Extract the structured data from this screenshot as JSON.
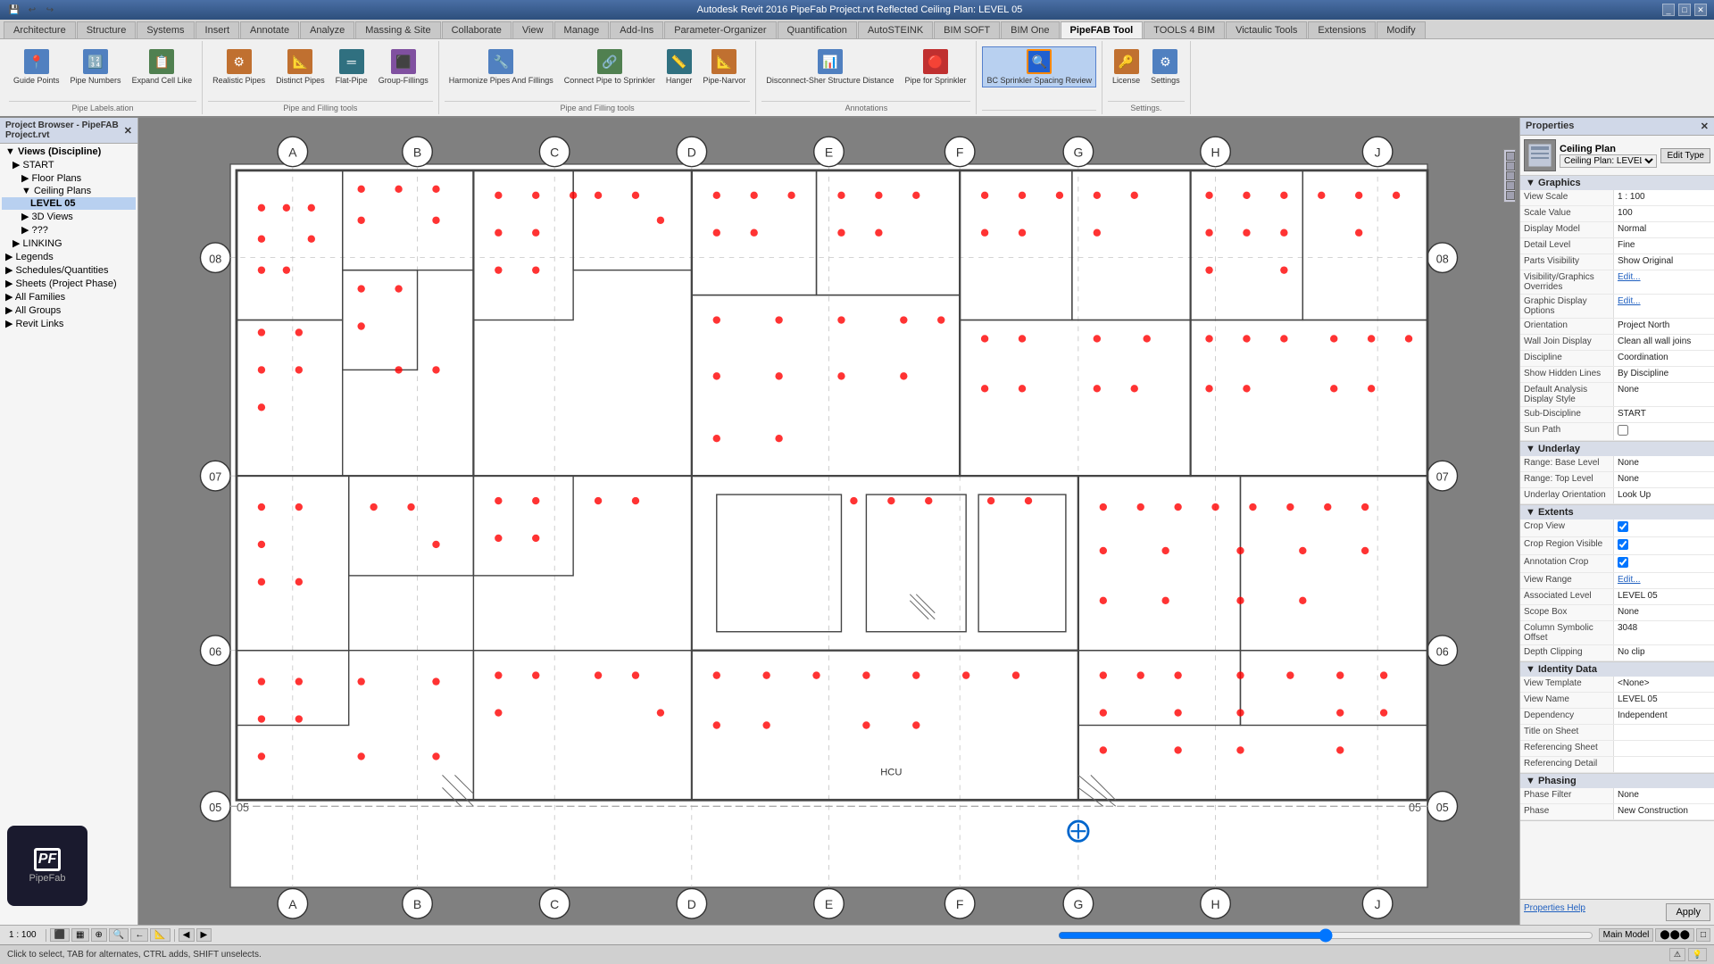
{
  "titleBar": {
    "text": "Autodesk Revit 2016    PipeFab Project.rvt    Reflected Ceiling Plan: LEVEL 05",
    "controls": [
      "minimize",
      "restore",
      "close"
    ]
  },
  "ribbonTabs": {
    "tabs": [
      {
        "label": "Architecture",
        "active": false
      },
      {
        "label": "Structure",
        "active": false
      },
      {
        "label": "Systems",
        "active": false
      },
      {
        "label": "Insert",
        "active": false
      },
      {
        "label": "Annotate",
        "active": false
      },
      {
        "label": "Analyze",
        "active": false
      },
      {
        "label": "Massing & Site",
        "active": false
      },
      {
        "label": "Collaborate",
        "active": false
      },
      {
        "label": "View",
        "active": false
      },
      {
        "label": "Manage",
        "active": false
      },
      {
        "label": "Add-Ins",
        "active": false
      },
      {
        "label": "Parameter-Organizer",
        "active": false
      },
      {
        "label": "Quantification",
        "active": false
      },
      {
        "label": "AutoSTEINK",
        "active": false
      },
      {
        "label": "BIM SOFT",
        "active": false
      },
      {
        "label": "BIM One",
        "active": false
      },
      {
        "label": "PipeFAB Tool",
        "active": false
      },
      {
        "label": "TOOLS 4 BIM",
        "active": false
      },
      {
        "label": "Victaulic Tools",
        "active": false
      },
      {
        "label": "Extensions",
        "active": false
      },
      {
        "label": "Modify",
        "active": false
      }
    ]
  },
  "ribbon": {
    "groups": [
      {
        "label": "Pipe Labels.ation",
        "tools": [
          {
            "icon": "📍",
            "label": "Guide Points",
            "color": "blue"
          },
          {
            "icon": "🔢",
            "label": "Pipe Numbers",
            "color": "blue"
          },
          {
            "icon": "📋",
            "label": "Expand Cell Like",
            "color": "green"
          }
        ]
      },
      {
        "label": "",
        "tools": [
          {
            "icon": "⚙",
            "label": "Realistic Pipes",
            "color": "orange"
          },
          {
            "icon": "📐",
            "label": "Distinct Pipes",
            "color": "orange"
          },
          {
            "icon": "═",
            "label": "Flat-Pipe",
            "color": "teal"
          },
          {
            "icon": "⬛",
            "label": "Group-Fillings",
            "color": "purple"
          }
        ]
      },
      {
        "label": "Pipe and Filling tools",
        "tools": [
          {
            "icon": "🔧",
            "label": "Harmonize Pipes And Fillings",
            "color": "blue"
          },
          {
            "icon": "🔗",
            "label": "Connect Pipe to Sprinkler",
            "color": "green"
          },
          {
            "icon": "📏",
            "label": "Hanger",
            "color": "teal"
          },
          {
            "icon": "📐",
            "label": "Pipe-Narvor",
            "color": "orange"
          }
        ]
      },
      {
        "label": "Annotations",
        "tools": [
          {
            "icon": "📊",
            "label": "Disconnect-Sher Structure Distance",
            "color": "blue"
          },
          {
            "icon": "🔴",
            "label": "Pipe for Sprinkler",
            "color": "red"
          }
        ]
      },
      {
        "label": "",
        "tools": [
          {
            "icon": "🔍",
            "label": "BC Sprinkler Spacing Review",
            "color": "active-blue",
            "active": true
          }
        ]
      },
      {
        "label": "Settings.",
        "tools": [
          {
            "icon": "⚙",
            "label": "License",
            "color": "orange"
          },
          {
            "icon": "🔧",
            "label": "Settings",
            "color": "blue"
          }
        ]
      }
    ]
  },
  "projectBrowser": {
    "title": "Project Browser - PipeFAB Project.rvt",
    "items": [
      {
        "label": "Views (Discipline)",
        "indent": 0,
        "arrow": "▼",
        "bold": true
      },
      {
        "label": "START",
        "indent": 1,
        "arrow": "▶",
        "bold": false
      },
      {
        "label": "Floor Plans",
        "indent": 2,
        "arrow": "▶",
        "bold": false
      },
      {
        "label": "Ceiling Plans",
        "indent": 2,
        "arrow": "▼",
        "bold": false
      },
      {
        "label": "LEVEL 05",
        "indent": 3,
        "arrow": "",
        "bold": true,
        "selected": true
      },
      {
        "label": "3D Views",
        "indent": 2,
        "arrow": "▶",
        "bold": false
      },
      {
        "label": "???",
        "indent": 2,
        "arrow": "▶",
        "bold": false
      },
      {
        "label": "LINKING",
        "indent": 1,
        "arrow": "▶",
        "bold": false
      },
      {
        "label": "Legends",
        "indent": 0,
        "arrow": "▶",
        "bold": false
      },
      {
        "label": "Schedules/Quantities",
        "indent": 0,
        "arrow": "▶",
        "bold": false
      },
      {
        "label": "Sheets (Project Phase)",
        "indent": 0,
        "arrow": "▶",
        "bold": false
      },
      {
        "label": "All Families",
        "indent": 0,
        "arrow": "▶",
        "bold": false
      },
      {
        "label": "All Groups",
        "indent": 0,
        "arrow": "▶",
        "bold": false
      },
      {
        "label": "Revit Links",
        "indent": 0,
        "arrow": "▶",
        "bold": false
      }
    ]
  },
  "properties": {
    "title": "Properties",
    "typeIcon": "🏗",
    "typeName": "Ceiling Plan",
    "typeSelector": "Ceiling Plan: LEVEL 05",
    "editTypeBtn": "Edit Type",
    "sections": [
      {
        "name": "Graphics",
        "rows": [
          {
            "label": "View Scale",
            "value": "1 : 100"
          },
          {
            "label": "Scale Value",
            "value": "100"
          },
          {
            "label": "Display Model",
            "value": "Normal"
          },
          {
            "label": "Detail Level",
            "value": "Fine"
          },
          {
            "label": "Parts Visibility",
            "value": "Show Original"
          },
          {
            "label": "Visibility/Graphics Overrides",
            "value": "Edit..."
          },
          {
            "label": "Graphic Display Options",
            "value": "Edit..."
          },
          {
            "label": "Orientation",
            "value": "Project North"
          },
          {
            "label": "Wall Join Display",
            "value": "Clean all wall joins"
          },
          {
            "label": "Discipline",
            "value": "Coordination"
          },
          {
            "label": "Show Hidden Lines",
            "value": "By Discipline"
          },
          {
            "label": "Default Analysis Display Style",
            "value": "None"
          },
          {
            "label": "Sub-Discipline",
            "value": "START"
          },
          {
            "label": "Sun Path",
            "value": ""
          }
        ]
      },
      {
        "name": "Underlay",
        "rows": [
          {
            "label": "Range: Base Level",
            "value": "None"
          },
          {
            "label": "Range: Top Level",
            "value": "None"
          },
          {
            "label": "Underlay Orientation",
            "value": "Look Up"
          }
        ]
      },
      {
        "name": "Extents",
        "rows": [
          {
            "label": "Crop View",
            "value": "✓"
          },
          {
            "label": "Crop Region Visible",
            "value": "✓"
          },
          {
            "label": "Annotation Crop",
            "value": "✓"
          },
          {
            "label": "View Range",
            "value": "Edit..."
          },
          {
            "label": "Associated Level",
            "value": "LEVEL 05"
          },
          {
            "label": "Scope Box",
            "value": "None"
          },
          {
            "label": "Column Symbolic Offset",
            "value": "3048"
          },
          {
            "label": "Depth Clipping",
            "value": "No clip"
          }
        ]
      },
      {
        "name": "Identity Data",
        "rows": [
          {
            "label": "View Template",
            "value": "<None>"
          },
          {
            "label": "View Name",
            "value": "LEVEL 05"
          },
          {
            "label": "Dependency",
            "value": "Independent"
          },
          {
            "label": "Title on Sheet",
            "value": ""
          },
          {
            "label": "Referencing Sheet",
            "value": ""
          },
          {
            "label": "Referencing Detail",
            "value": ""
          }
        ]
      },
      {
        "name": "Phasing",
        "rows": [
          {
            "label": "Phase Filter",
            "value": "None"
          },
          {
            "label": "Phase",
            "value": "New Construction"
          }
        ]
      }
    ],
    "footer": {
      "applyBtn": "Apply",
      "helpLink": "Properties Help"
    }
  },
  "floorPlan": {
    "gridLetters": [
      "A",
      "B",
      "C",
      "D",
      "E",
      "F",
      "G",
      "H",
      "J"
    ],
    "gridNumbers": [
      "05",
      "06",
      "07",
      "08"
    ],
    "scale": "1 : 100"
  },
  "statusBar": {
    "scale": "1 : 100",
    "status": "Click to select, TAB for alternates, CTRL adds, SHIFT unselects.",
    "mode": "Main Model"
  },
  "logo": {
    "pf": "PF",
    "brand": "PipeFab"
  }
}
